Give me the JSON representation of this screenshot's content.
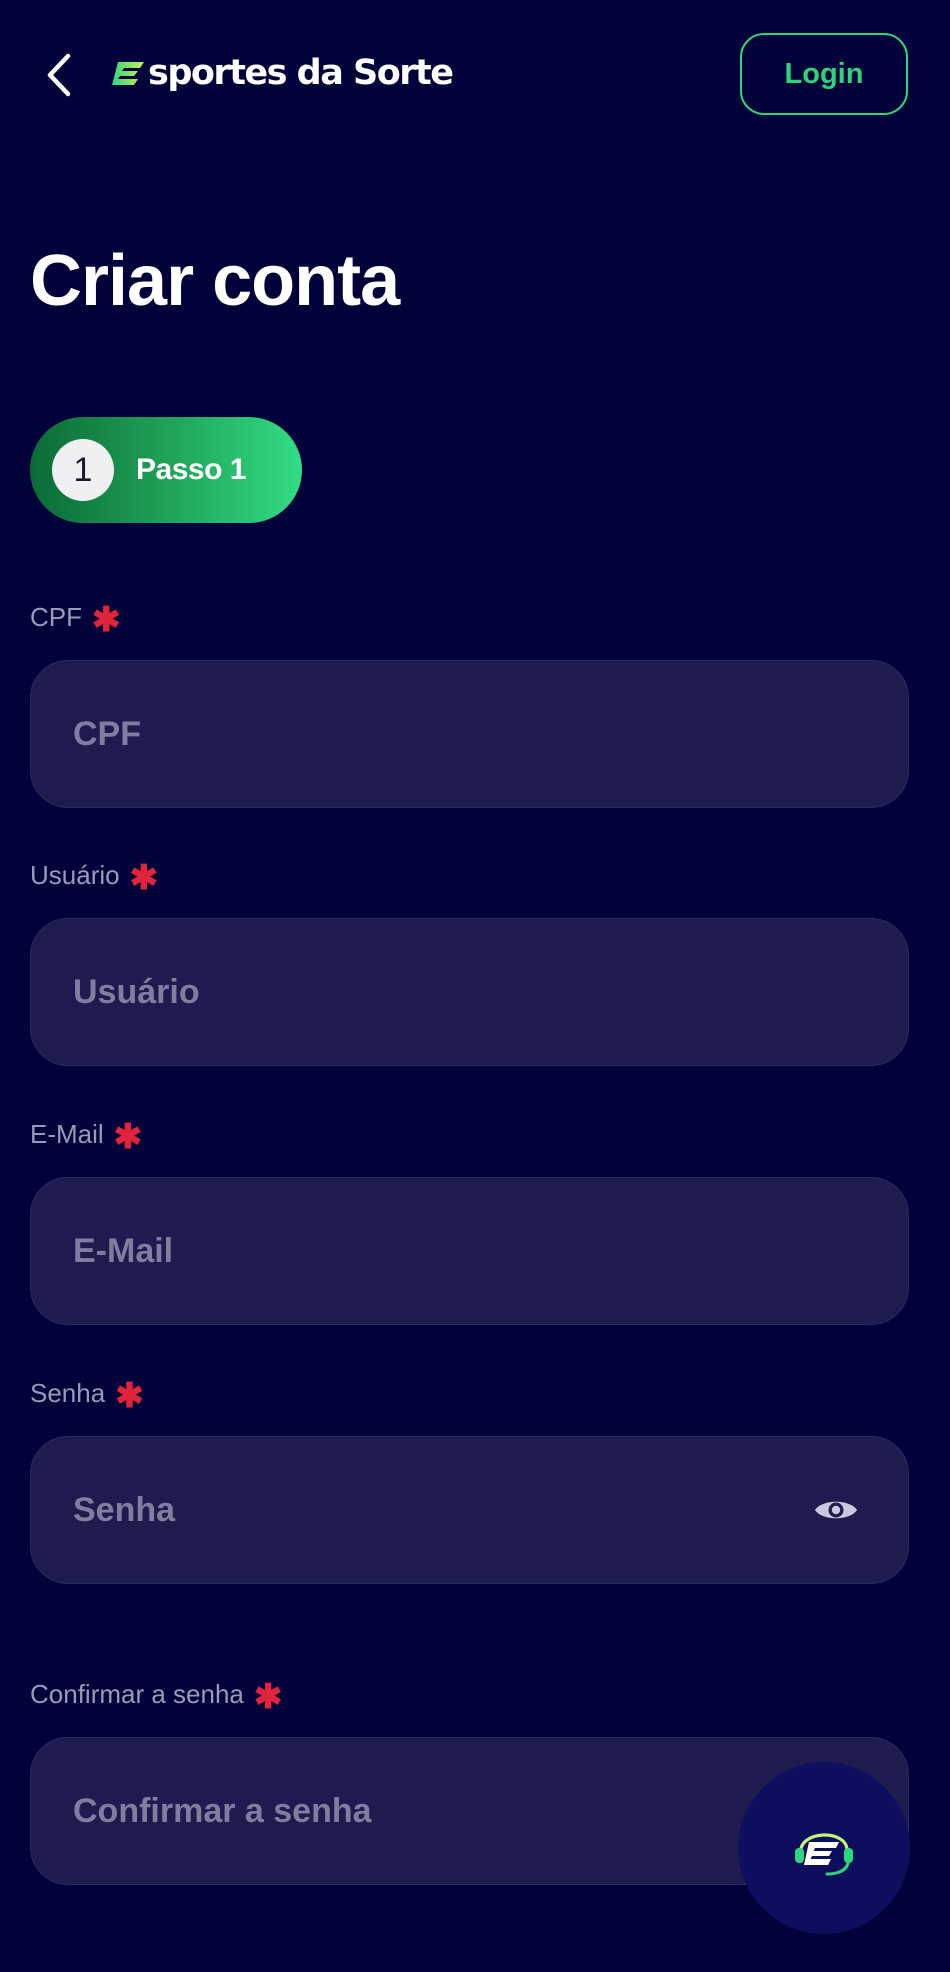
{
  "header": {
    "back_icon": "chevron-left-icon",
    "brand": "Esportes da Sorte",
    "logo_wordmark": "sportes da Sorte",
    "login_label": "Login"
  },
  "page": {
    "title": "Criar conta"
  },
  "stepper": {
    "number": "1",
    "label": "Passo 1"
  },
  "form": {
    "fields": [
      {
        "label": "CPF",
        "placeholder": "CPF",
        "value": "",
        "required": true
      },
      {
        "label": "Usuário",
        "placeholder": "Usuário",
        "value": "",
        "required": true
      },
      {
        "label": "E-Mail",
        "placeholder": "E-Mail",
        "value": "",
        "required": true
      },
      {
        "label": "Senha",
        "placeholder": "Senha",
        "value": "",
        "required": true,
        "icon": "eye-icon"
      },
      {
        "label": "Confirmar a senha",
        "placeholder": "Confirmar a senha",
        "value": "",
        "required": true
      }
    ],
    "required_marker": "✱"
  },
  "support": {
    "icon": "support-headset-icon"
  },
  "colors": {
    "background": "#02023a",
    "field_background": "#1e1c4e",
    "accent_green": "#2ed47a",
    "required_red": "#e0243c",
    "label_gray": "#9a9ab8",
    "placeholder_gray": "#7e7ea0"
  }
}
